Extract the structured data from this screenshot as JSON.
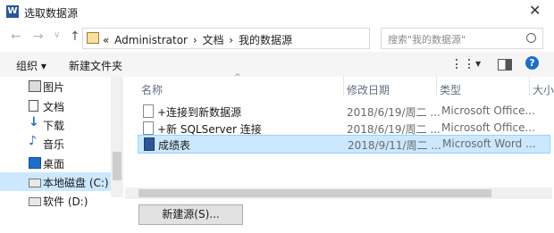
{
  "window": {
    "title": "选取数据源",
    "close": "✕"
  },
  "nav": {
    "back": "←",
    "forward": "→",
    "recent": "∨",
    "up": "↑",
    "path_prefix": "«",
    "breadcrumb": [
      "Administrator",
      "文档",
      "我的数据源"
    ],
    "sep": "›",
    "search_placeholder": "搜索\"我的数据源\""
  },
  "toolbar": {
    "organize": "组织 ▾",
    "new_folder": "新建文件夹"
  },
  "sidebar": {
    "items": [
      {
        "label": "图片",
        "icon": "pictures-icon"
      },
      {
        "label": "文档",
        "icon": "documents-icon"
      },
      {
        "label": "下载",
        "icon": "download-icon"
      },
      {
        "label": "音乐",
        "icon": "music-icon"
      },
      {
        "label": "桌面",
        "icon": "desktop-icon"
      },
      {
        "label": "本地磁盘 (C:)",
        "icon": "drive-icon"
      },
      {
        "label": "软件 (D:)",
        "icon": "drive-icon"
      }
    ],
    "selected_index": 5
  },
  "list": {
    "columns": [
      "名称",
      "修改日期",
      "类型",
      "大小"
    ],
    "rows": [
      {
        "name": "+连接到新数据源",
        "date": "2018/6/19/周二 ...",
        "type": "Microsoft Office..."
      },
      {
        "name": "+新 SQLServer 连接",
        "date": "2018/6/19/周二 ...",
        "type": "Microsoft Office..."
      },
      {
        "name": "成绩表",
        "date": "2018/9/11/周二 ...",
        "type": "Microsoft Word ..."
      }
    ],
    "selected_row": 2
  },
  "buttons": {
    "new_source": "新建源(S)..."
  },
  "colors": {
    "accent": "#1a6fc9",
    "selection": "#cce8ff"
  }
}
